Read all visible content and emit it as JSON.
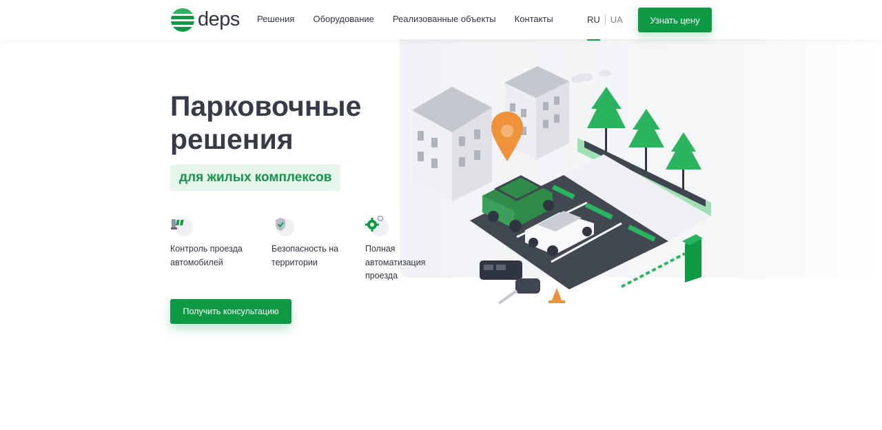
{
  "brand": {
    "name": "deps",
    "accent": "#0e9a45"
  },
  "nav": {
    "items": [
      {
        "label": "Решения"
      },
      {
        "label": "Оборудование"
      },
      {
        "label": "Реализованные объекты"
      },
      {
        "label": "Контакты"
      }
    ]
  },
  "lang": {
    "active": "RU",
    "other": "UA"
  },
  "header": {
    "cta_label": "Узнать цену"
  },
  "hero": {
    "title": "Парковочные решения",
    "tag": "для жилых комплексов",
    "features": [
      {
        "icon": "barrier-icon",
        "label": "Контроль проезда автомобилей"
      },
      {
        "icon": "shield-check-icon",
        "label": "Безопасность на территории"
      },
      {
        "icon": "gear-icon",
        "label": "Полная автоматизация проезда"
      }
    ],
    "cta_label": "Получить консультацию"
  }
}
